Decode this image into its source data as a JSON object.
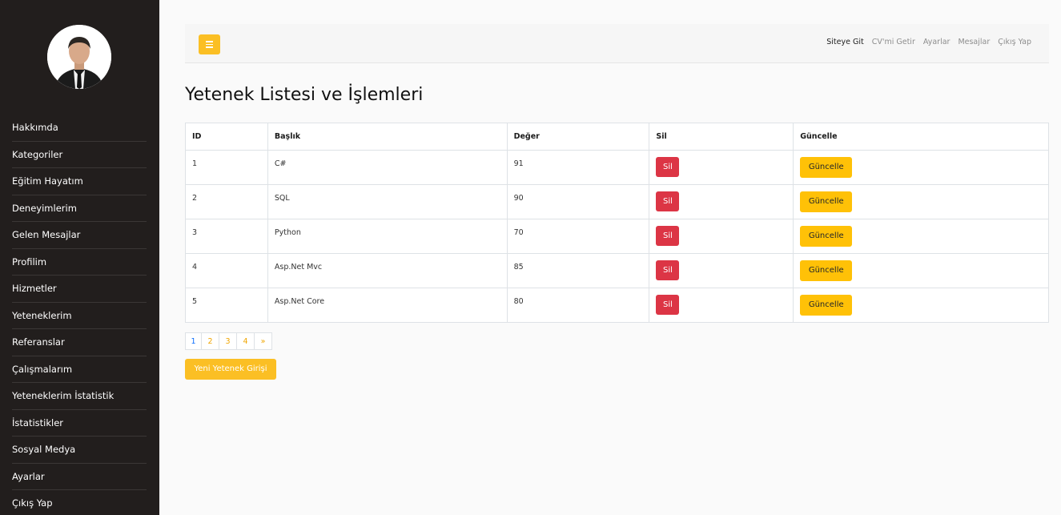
{
  "sidebar": {
    "items": [
      {
        "label": "Hakkımda"
      },
      {
        "label": "Kategoriler"
      },
      {
        "label": "Eğitim Hayatım"
      },
      {
        "label": "Deneyimlerim"
      },
      {
        "label": "Gelen Mesajlar"
      },
      {
        "label": "Profilim"
      },
      {
        "label": "Hizmetler"
      },
      {
        "label": "Yeteneklerim"
      },
      {
        "label": "Referanslar"
      },
      {
        "label": "Çalışmalarım"
      },
      {
        "label": "Yeteneklerim İstatistik"
      },
      {
        "label": "İstatistikler"
      },
      {
        "label": "Sosyal Medya"
      },
      {
        "label": "Ayarlar"
      },
      {
        "label": "Çıkış Yap"
      }
    ]
  },
  "topbar": {
    "toggle_icon": "menu-icon",
    "links": [
      {
        "label": "Siteye Git"
      },
      {
        "label": "CV'mi Getir"
      },
      {
        "label": "Ayarlar"
      },
      {
        "label": "Mesajlar"
      },
      {
        "label": "Çıkış Yap"
      }
    ]
  },
  "page": {
    "title": "Yetenek Listesi ve İşlemleri"
  },
  "table": {
    "headers": {
      "id": "ID",
      "title": "Başlık",
      "value": "Değer",
      "delete": "Sil",
      "update": "Güncelle"
    },
    "rows": [
      {
        "id": "1",
        "title": "C#",
        "value": "91",
        "delete_label": "Sil",
        "update_label": "Güncelle"
      },
      {
        "id": "2",
        "title": "SQL",
        "value": "90",
        "delete_label": "Sil",
        "update_label": "Güncelle"
      },
      {
        "id": "3",
        "title": "Python",
        "value": "70",
        "delete_label": "Sil",
        "update_label": "Güncelle"
      },
      {
        "id": "4",
        "title": "Asp.Net Mvc",
        "value": "85",
        "delete_label": "Sil",
        "update_label": "Güncelle"
      },
      {
        "id": "5",
        "title": "Asp.Net Core",
        "value": "80",
        "delete_label": "Sil",
        "update_label": "Güncelle"
      }
    ]
  },
  "pagination": {
    "pages": [
      "1",
      "2",
      "3",
      "4"
    ],
    "next": "»",
    "current": "1"
  },
  "new_button_label": "Yeni Yetenek Girişi",
  "colors": {
    "sidebar_bg": "#221e1d",
    "accent": "#fbbf24",
    "danger": "#dc3545",
    "warning": "#ffc107"
  }
}
